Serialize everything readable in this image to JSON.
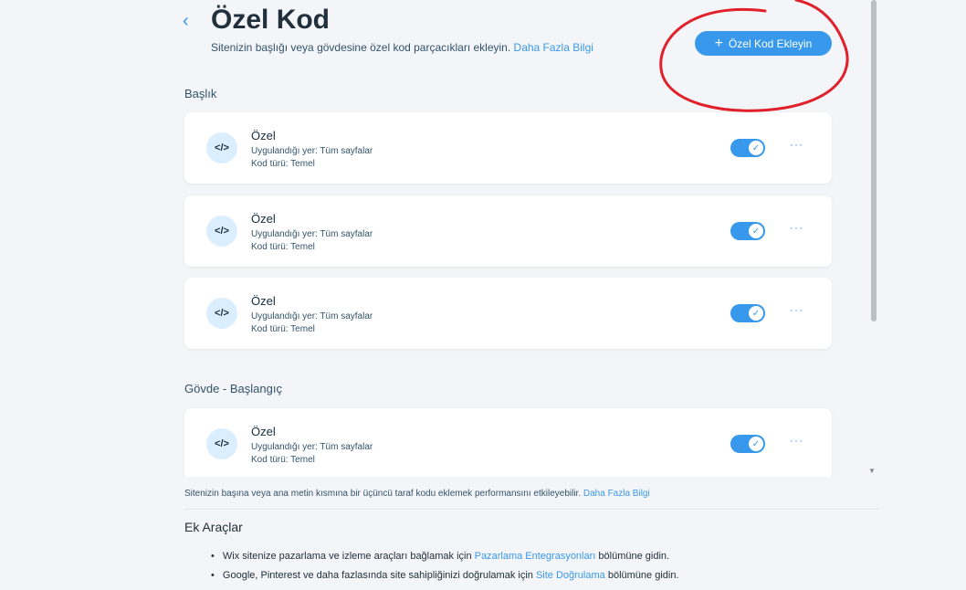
{
  "header": {
    "back_icon": "‹",
    "title": "Özel Kod",
    "subtitle": "Sitenizin başlığı veya gövdesine özel kod parçacıkları ekleyin.",
    "learn_more": "Daha Fazla Bilgi",
    "add_button_icon": "+",
    "add_button_label": "Özel Kod Ekleyin"
  },
  "sections": {
    "head_label": "Başlık",
    "body_start_label": "Gövde - Başlangıç"
  },
  "cards": [
    {
      "icon": "</>",
      "title": "Özel",
      "applied": "Uygulandığı yer: Tüm sayfalar",
      "code_type": "Kod türü: Temel",
      "enabled": true
    },
    {
      "icon": "</>",
      "title": "Özel",
      "applied": "Uygulandığı yer: Tüm sayfalar",
      "code_type": "Kod türü: Temel",
      "enabled": true
    },
    {
      "icon": "</>",
      "title": "Özel",
      "applied": "Uygulandığı yer: Tüm sayfalar",
      "code_type": "Kod türü: Temel",
      "enabled": true
    },
    {
      "icon": "</>",
      "title": "Özel",
      "applied": "Uygulandığı yer: Tüm sayfalar",
      "code_type": "Kod türü: Temel",
      "enabled": true
    }
  ],
  "more_icon": "···",
  "check_icon": "✓",
  "notice": {
    "text": "Sitenizin başına veya ana metin kısmına bir üçüncü taraf kodu eklemek performansını etkileyebilir.",
    "link": "Daha Fazla Bilgi"
  },
  "extra_tools": {
    "title": "Ek Araçlar",
    "items": [
      {
        "before": "Wix sitenize pazarlama ve izleme araçları bağlamak için",
        "link": "Pazarlama Entegrasyonları",
        "after": "bölümüne gidin."
      },
      {
        "before": "Google, Pinterest ve daha fazlasında site sahipliğinizi doğrulamak için",
        "link": "Site Doğrulama",
        "after": "bölümüne gidin."
      }
    ]
  },
  "colors": {
    "accent": "#3899ec",
    "annotation": "#e0202a"
  }
}
